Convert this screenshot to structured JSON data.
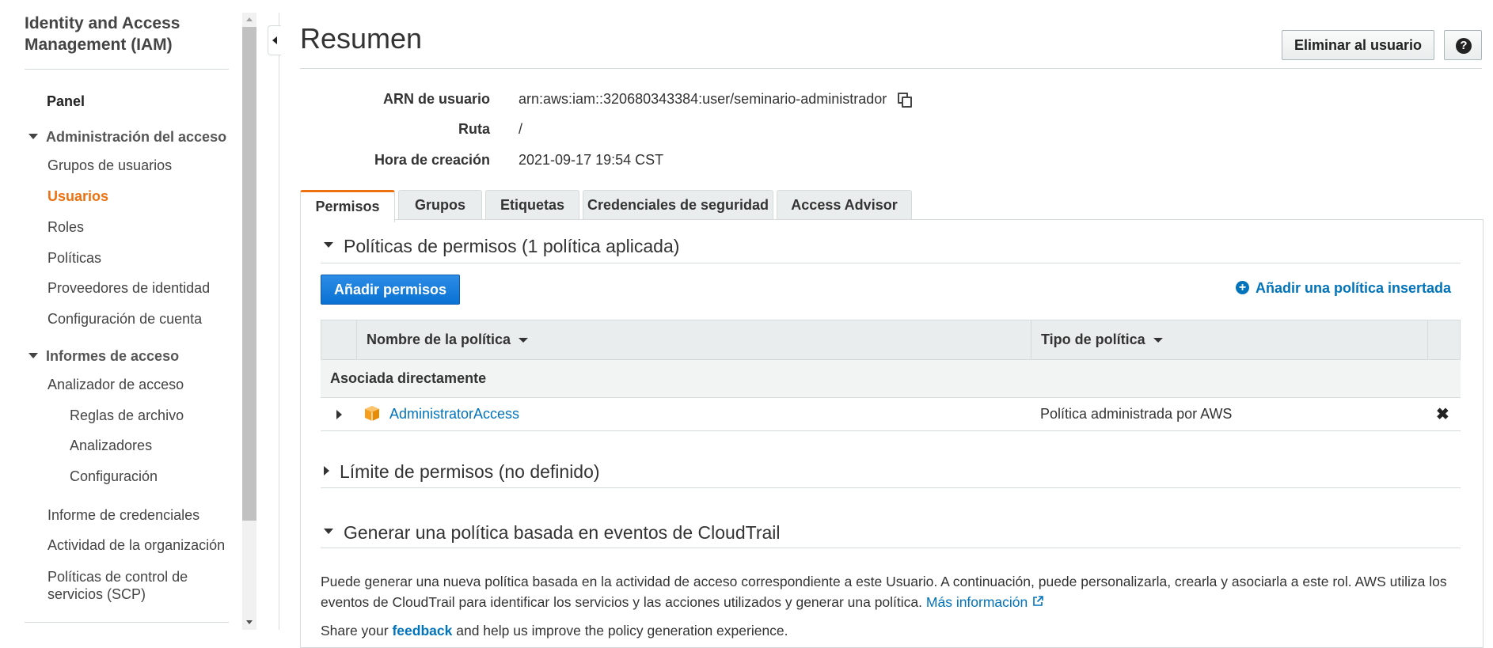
{
  "sidebar": {
    "title": "Identity and Access Management (IAM)",
    "panel": "Panel",
    "section_access_management": "Administración del acceso",
    "access_items": [
      "Grupos de usuarios",
      "Usuarios",
      "Roles",
      "Políticas",
      "Proveedores de identidad",
      "Configuración de cuenta"
    ],
    "active_item": "Usuarios",
    "section_access_reports": "Informes de acceso",
    "report_items": [
      "Analizador de acceso",
      "Reglas de archivo",
      "Analizadores",
      "Configuración",
      "Informe de credenciales",
      "Actividad de la organización",
      "Políticas de control de servicios (SCP)"
    ]
  },
  "header": {
    "title": "Resumen",
    "delete_user_button": "Eliminar al usuario",
    "help_button": "?"
  },
  "summary": {
    "arn_label": "ARN de usuario",
    "arn_value": "arn:aws:iam::320680343384:user/seminario-administrador",
    "path_label": "Ruta",
    "path_value": "/",
    "created_label": "Hora de creación",
    "created_value": "2021-09-17 19:54 CST"
  },
  "tabs": [
    "Permisos",
    "Grupos",
    "Etiquetas",
    "Credenciales de seguridad",
    "Access Advisor"
  ],
  "active_tab": "Permisos",
  "permissions": {
    "policies_heading": "Políticas de permisos (1 política aplicada)",
    "add_permissions_button": "Añadir permisos",
    "add_inline_policy_link": "Añadir una política insertada",
    "table": {
      "columns": [
        "Nombre de la política",
        "Tipo de política"
      ],
      "group_label": "Asociada directamente",
      "rows": [
        {
          "name": "AdministratorAccess",
          "type": "Política administrada por AWS"
        }
      ]
    },
    "boundary_heading": "Límite de permisos (no definido)",
    "cloudtrail_heading": "Generar una política basada en eventos de CloudTrail",
    "cloudtrail_description": "Puede generar una nueva política basada en la actividad de acceso correspondiente a este Usuario. A continuación, puede personalizarla, crearla y asociarla a este rol. AWS utiliza los eventos de CloudTrail para identificar los servicios y las acciones utilizados y generar una política.",
    "more_info_link": "Más información",
    "feedback_prefix": "Share your",
    "feedback_link": "feedback",
    "feedback_suffix": "and help us improve the policy generation experience."
  },
  "colors": {
    "accent_orange": "#ec7211",
    "link_blue": "#0073bb",
    "primary_button": "#0972d3"
  },
  "icons": [
    "copy-icon",
    "help-icon",
    "plus-circle-icon",
    "sort-caret-icon",
    "policy-box-icon",
    "remove-icon",
    "external-link-icon",
    "collapse-sidebar-icon"
  ]
}
